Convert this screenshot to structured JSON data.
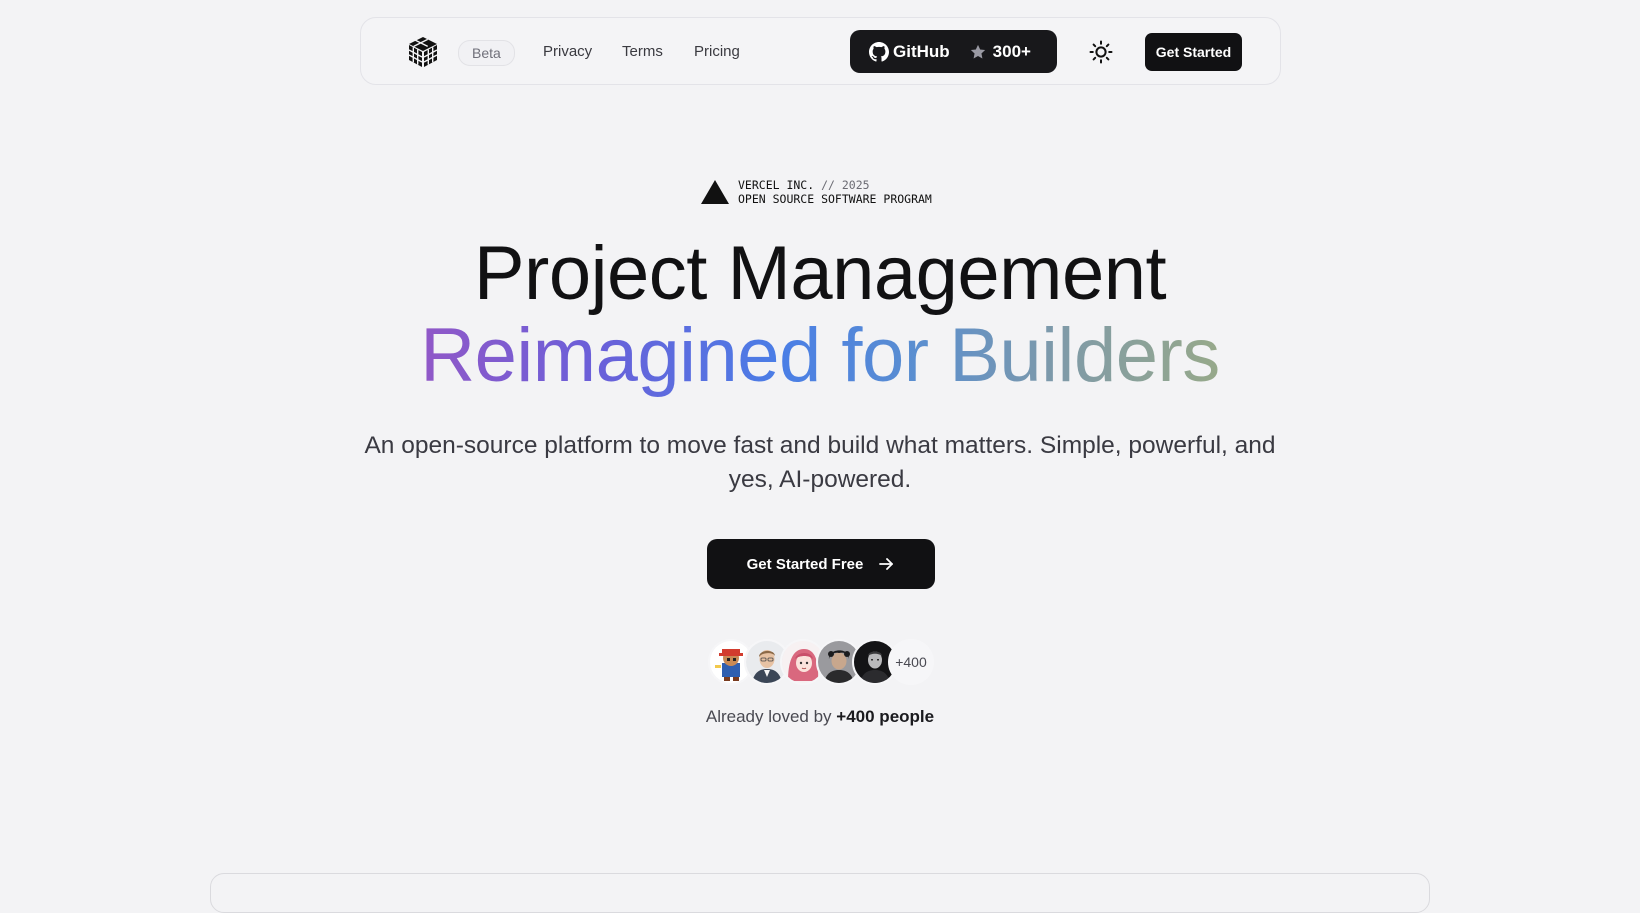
{
  "nav": {
    "beta_label": "Beta",
    "links": [
      "Privacy",
      "Terms",
      "Pricing"
    ],
    "github_label": "GitHub",
    "github_stars": "300+",
    "cta_label": "Get Started"
  },
  "hero": {
    "badge_company": "VERCEL INC.",
    "badge_year": "// 2025",
    "badge_program": "OPEN SOURCE SOFTWARE PROGRAM",
    "title_line1": "Project Management",
    "title_line2": "Reimagined for Builders",
    "subtitle": "An open-source platform to move fast and build what matters. Simple, powerful, and yes, AI-powered.",
    "cta_label": "Get Started Free"
  },
  "social_proof": {
    "more_count": "+400",
    "loved_prefix": "Already loved by",
    "loved_count": "+400 people"
  },
  "colors": {
    "background": "#f3f3f5",
    "primary_button": "#111113",
    "gradient": [
      "#9158c7",
      "#4a7ee6",
      "#97a98a"
    ]
  },
  "icons": [
    "logo-icon",
    "github-icon",
    "star-icon",
    "sun-icon",
    "arrow-right-icon",
    "vercel-triangle-icon"
  ]
}
